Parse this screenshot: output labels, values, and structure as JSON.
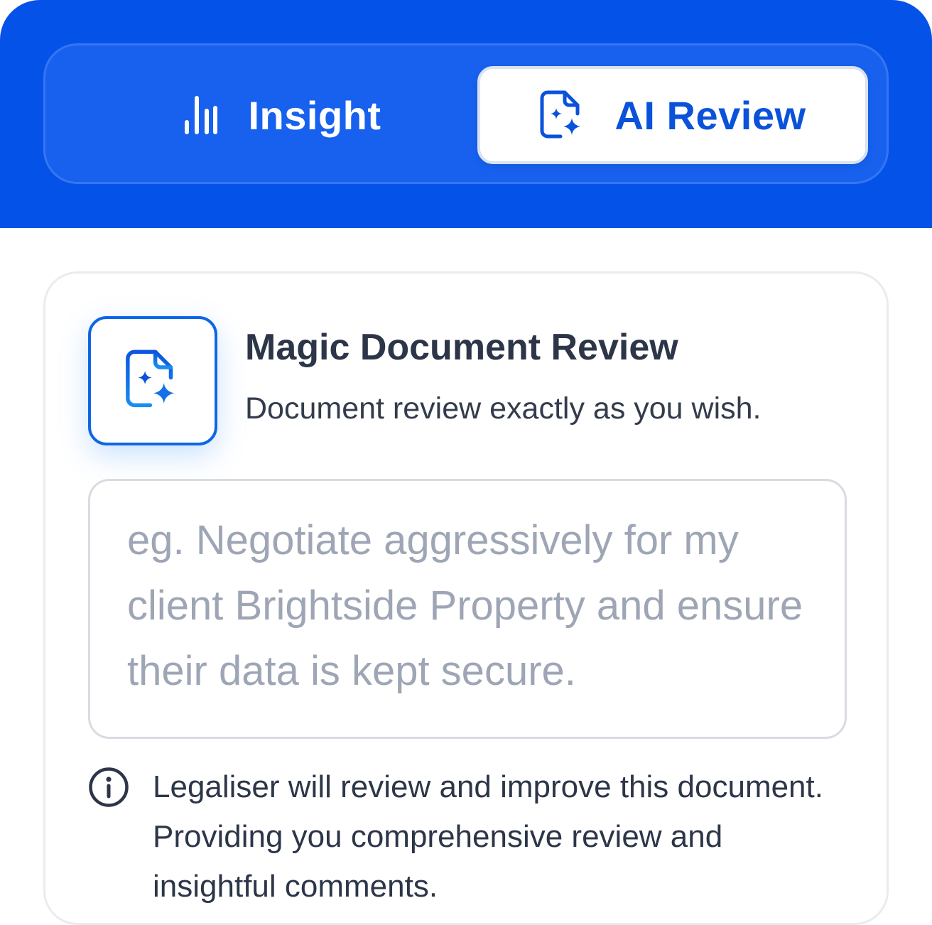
{
  "tabs": {
    "insight": {
      "label": "Insight",
      "icon": "bar-chart-icon"
    },
    "ai_review": {
      "label": "AI Review",
      "icon": "document-sparkle-icon"
    }
  },
  "card": {
    "title": "Magic Document Review",
    "subtitle": "Document review exactly as you wish.",
    "icon": "document-sparkle-icon",
    "prompt": {
      "value": "",
      "placeholder": "eg. Negotiate aggressively for my client Brightside Property and ensure their data is kept secure."
    },
    "info": {
      "icon": "info-icon",
      "text": "Legaliser will review and improve this document. Providing you comprehensive review and insightful comments."
    }
  },
  "colors": {
    "header_bg": "#0552e8",
    "accent": "#0b52db",
    "title_text": "#2c3648",
    "placeholder_text": "#9ea6b5"
  }
}
